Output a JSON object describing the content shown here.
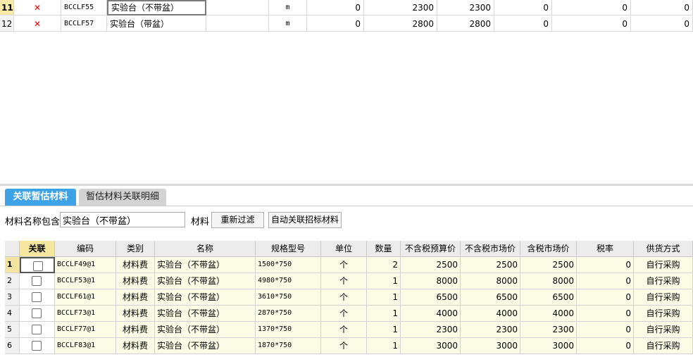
{
  "top_table": {
    "rows": [
      {
        "num": "11",
        "flag": "✕",
        "code": "BCCLF55",
        "name": "实验台（不带盆）",
        "spec": "",
        "unit": "m",
        "v1": "0",
        "v2": "2300",
        "v3": "2300",
        "v4": "0",
        "v5": "0",
        "v6": "0"
      },
      {
        "num": "12",
        "flag": "✕",
        "code": "BCCLF57",
        "name": "实验台（带盆）",
        "spec": "",
        "unit": "m",
        "v1": "0",
        "v2": "2800",
        "v3": "2800",
        "v4": "0",
        "v5": "0",
        "v6": "0"
      }
    ]
  },
  "tabs": [
    {
      "label": "关联暂估材料",
      "active": true
    },
    {
      "label": "暂估材料关联明细",
      "active": false
    }
  ],
  "filter": {
    "label": "材料名称包含",
    "value": "实验台（不带盆）",
    "label2": "材料",
    "refilter_button": "重新过滤",
    "auto_button": "自动关联招标材料"
  },
  "bottom_table": {
    "headers": [
      "",
      "关联",
      "编码",
      "类别",
      "名称",
      "规格型号",
      "单位",
      "数量",
      "不含税预算价",
      "不含税市场价",
      "含税市场价",
      "税率",
      "供货方式"
    ],
    "rows": [
      {
        "num": "1",
        "code": "BCCLF49@1",
        "type": "材料费",
        "name": "实验台（不带盆）",
        "spec": "1500*750",
        "unit": "个",
        "qty": "2",
        "p1": "2500",
        "p2": "2500",
        "p3": "2500",
        "tax": "0",
        "supply": "自行采购"
      },
      {
        "num": "2",
        "code": "BCCLF53@1",
        "type": "材料费",
        "name": "实验台（不带盆）",
        "spec": "4980*750",
        "unit": "个",
        "qty": "1",
        "p1": "8000",
        "p2": "8000",
        "p3": "8000",
        "tax": "0",
        "supply": "自行采购"
      },
      {
        "num": "3",
        "code": "BCCLF61@1",
        "type": "材料费",
        "name": "实验台（不带盆）",
        "spec": "3610*750",
        "unit": "个",
        "qty": "1",
        "p1": "6500",
        "p2": "6500",
        "p3": "6500",
        "tax": "0",
        "supply": "自行采购"
      },
      {
        "num": "4",
        "code": "BCCLF73@1",
        "type": "材料费",
        "name": "实验台（不带盆）",
        "spec": "2870*750",
        "unit": "个",
        "qty": "1",
        "p1": "4000",
        "p2": "4000",
        "p3": "4000",
        "tax": "0",
        "supply": "自行采购"
      },
      {
        "num": "5",
        "code": "BCCLF77@1",
        "type": "材料费",
        "name": "实验台（不带盆）",
        "spec": "1370*750",
        "unit": "个",
        "qty": "1",
        "p1": "2300",
        "p2": "2300",
        "p3": "2300",
        "tax": "0",
        "supply": "自行采购"
      },
      {
        "num": "6",
        "code": "BCCLF83@1",
        "type": "材料费",
        "name": "实验台（不带盆）",
        "spec": "1870*750",
        "unit": "个",
        "qty": "1",
        "p1": "3000",
        "p2": "3000",
        "p3": "3000",
        "tax": "0",
        "supply": "自行采购"
      }
    ]
  },
  "colors": {
    "tab_active": "#3ea2e6",
    "row_highlight": "#fbfbe6",
    "delete_mark": "#e00000"
  }
}
